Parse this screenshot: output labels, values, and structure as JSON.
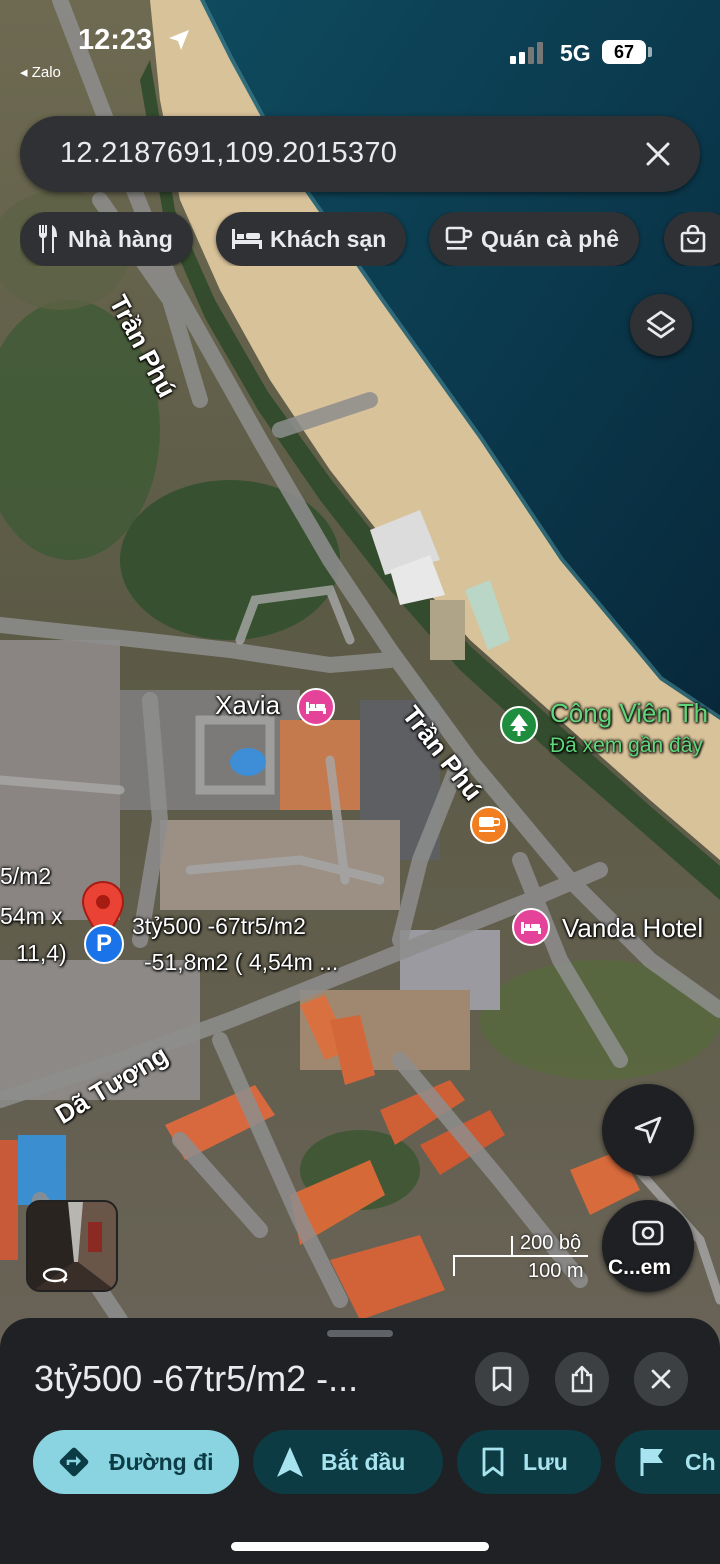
{
  "status_bar": {
    "time": "12:23",
    "back_app": "◂ Zalo",
    "network": "5G",
    "battery": "67"
  },
  "search": {
    "value": "12.2187691,109.2015370"
  },
  "chips": [
    {
      "label": "Nhà hàng",
      "icon": "fork-knife-icon"
    },
    {
      "label": "Khách sạn",
      "icon": "bed-icon"
    },
    {
      "label": "Quán cà phê",
      "icon": "coffee-cup-icon"
    },
    {
      "label": "",
      "icon": "shopping-bag-icon"
    }
  ],
  "map": {
    "roads": {
      "tran_phu_top": "Trần Phú",
      "tran_phu_mid": "Trần Phú",
      "da_tuong": "Dã Tượng"
    },
    "pois": {
      "xavia": "Xavia",
      "park_name": "Công Viên Th",
      "park_sub": "Đã xem gần đây",
      "vanda": "Vanda Hotel"
    },
    "pin": {
      "line1": "3tỷ500 -67tr5/m2",
      "line2": "-51,8m2 ( 4,54m ..."
    },
    "left_cut_label": {
      "line1": "5/m2",
      "line2": "54m x",
      "line3": "11,4)"
    },
    "scale": {
      "feet": "200 bộ",
      "meters": "100 m"
    },
    "lens_label": "C...em",
    "colors": {
      "hotel_pin": "#e5429a",
      "cafe_pin": "#f17f22",
      "park_pin": "#1e8e3e",
      "marker_red": "#ea4335",
      "parking_blue": "#1a73e8"
    }
  },
  "sheet": {
    "title": "3tỷ500 -67tr5/m2 -...",
    "actions": [
      {
        "label": "Đường đi",
        "icon": "directions-icon"
      },
      {
        "label": "Bắt đầu",
        "icon": "navigation-arrow-icon"
      },
      {
        "label": "Lưu",
        "icon": "bookmark-icon"
      },
      {
        "label": "Ch",
        "icon": "flag-icon"
      }
    ]
  }
}
